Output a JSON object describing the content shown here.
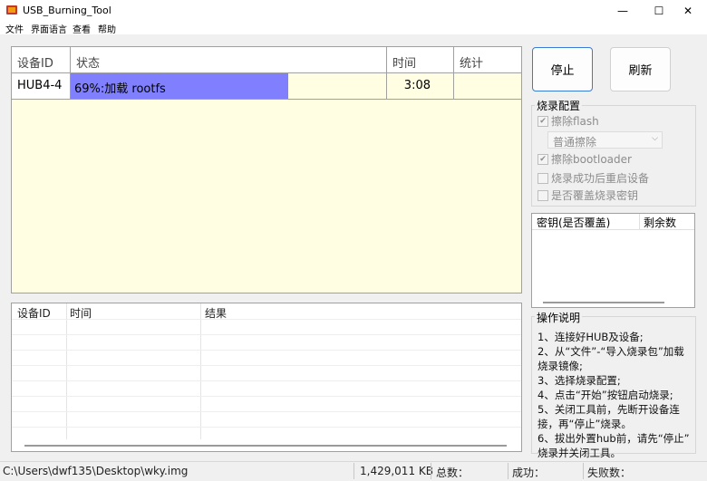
{
  "window": {
    "title": "USB_Burning_Tool",
    "controls": {
      "minimize": "—",
      "maximize": "☐",
      "close": "✕"
    }
  },
  "menu": [
    "文件",
    "界面语言",
    "查看",
    "帮助"
  ],
  "grid": {
    "headers": {
      "device_id": "设备ID",
      "status": "状态",
      "time": "时间",
      "stats": "统计"
    },
    "rows": [
      {
        "device_id": "HUB4-4",
        "status": "69%:加载 rootfs",
        "progress": 0.69,
        "time": "3:08",
        "stats": ""
      }
    ],
    "progress_color": "#8080ff",
    "background_color": "#fffee3"
  },
  "results": {
    "headers": {
      "device_id": "设备ID",
      "time": "时间",
      "result": "结果"
    }
  },
  "buttons": {
    "stop": "停止",
    "refresh": "刷新"
  },
  "config": {
    "title": "烧录配置",
    "erase_flash": {
      "label": "擦除flash",
      "checked": true
    },
    "erase_mode": "普通擦除",
    "erase_bootloader": {
      "label": "擦除bootloader",
      "checked": true
    },
    "reboot_after": {
      "label": "烧录成功后重启设备",
      "checked": false
    },
    "overwrite_key": {
      "label": "是否覆盖烧录密钥",
      "checked": false
    }
  },
  "keys": {
    "headers": {
      "key": "密钥(是否覆盖)",
      "remaining": "剩余数"
    }
  },
  "help": {
    "title": "操作说明",
    "lines": [
      "1、连接好HUB及设备;",
      "2、从“文件”-“导入烧录包”加载",
      "烧录镜像;",
      "3、选择烧录配置;",
      "4、点击“开始”按钮启动烧录;",
      "5、关闭工具前，先断开设备连",
      "接，再“停止”烧录。",
      "6、拔出外置hub前，请先“停止”",
      "烧录并关闭工具。"
    ]
  },
  "statusbar": {
    "path": "C:\\Users\\dwf135\\Desktop\\wky.img",
    "size": "1,429,011 KB",
    "total": "总数：",
    "success": "成功：",
    "failed": "失败数："
  }
}
